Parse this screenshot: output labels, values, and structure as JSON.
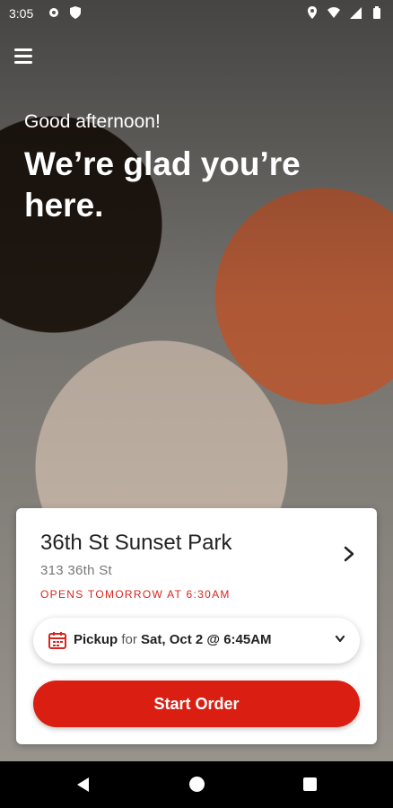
{
  "status_bar": {
    "time": "3:05"
  },
  "header": {
    "greeting": "Good afternoon!",
    "headline": "We’re glad you’re here."
  },
  "store_card": {
    "name": "36th St Sunset Park",
    "address": "313 36th St",
    "status": "OPENS TOMORROW AT 6:30AM",
    "pickup": {
      "mode": "Pickup",
      "for_text": "for",
      "datetime": "Sat, Oct 2 @ 6:45AM"
    },
    "start_button": "Start Order"
  },
  "colors": {
    "accent": "#da1f12",
    "status_text": "#d7261e"
  }
}
